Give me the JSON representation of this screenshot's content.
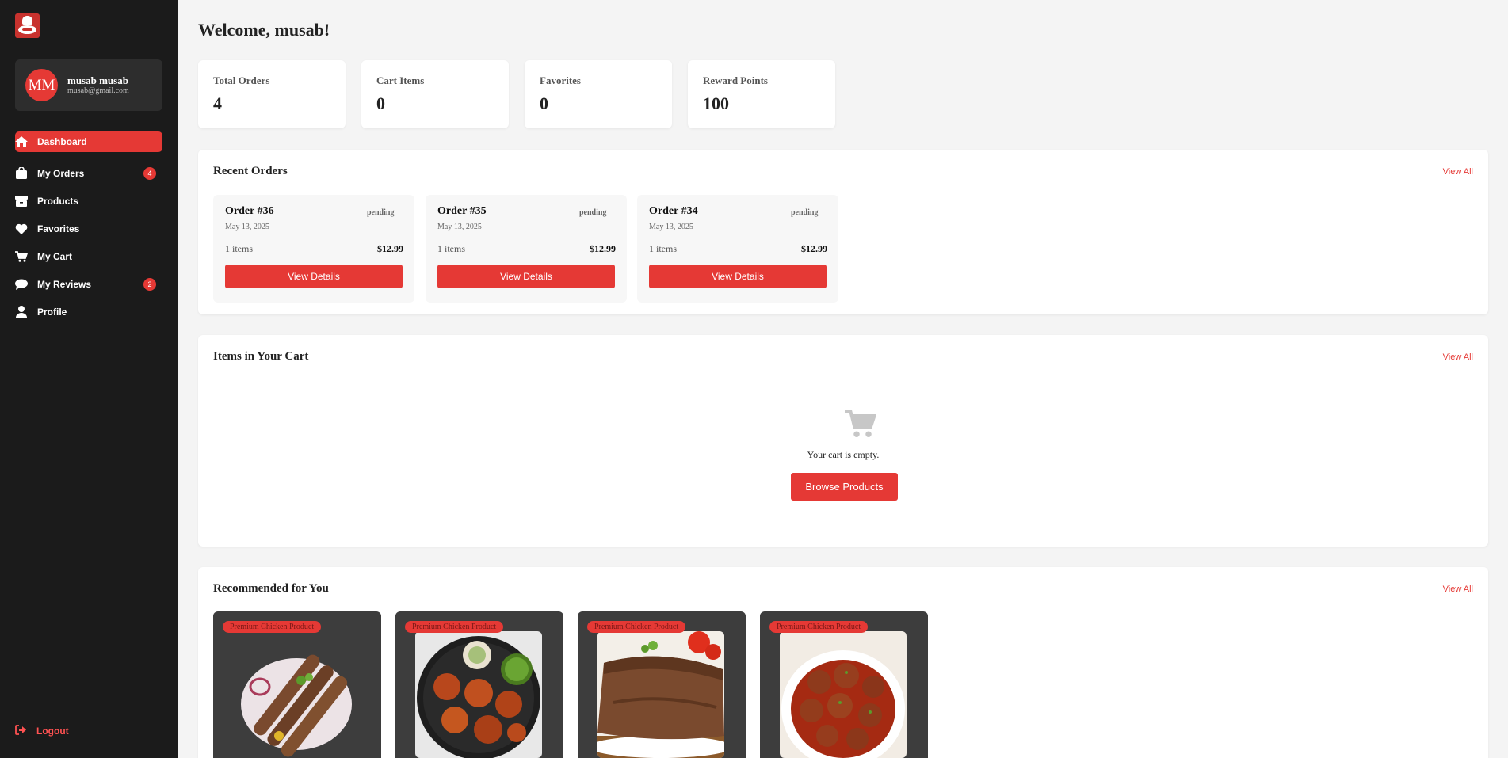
{
  "user": {
    "initials": "MM",
    "name": "musab musab",
    "email": "musab@gmail.com"
  },
  "nav": {
    "items": [
      {
        "label": "Dashboard",
        "icon": "home-icon",
        "active": true
      },
      {
        "label": "My Orders",
        "icon": "shopping-bag-icon",
        "badge": "4"
      },
      {
        "label": "Products",
        "icon": "box-icon"
      },
      {
        "label": "Favorites",
        "icon": "heart-icon"
      },
      {
        "label": "My Cart",
        "icon": "cart-icon"
      },
      {
        "label": "My Reviews",
        "icon": "comment-icon",
        "badge": "2"
      },
      {
        "label": "Profile",
        "icon": "user-icon"
      }
    ],
    "logout": "Logout"
  },
  "welcome": "Welcome, musab!",
  "stats": [
    {
      "label": "Total Orders",
      "value": "4"
    },
    {
      "label": "Cart Items",
      "value": "0"
    },
    {
      "label": "Favorites",
      "value": "0"
    },
    {
      "label": "Reward Points",
      "value": "100"
    }
  ],
  "recent_orders": {
    "title": "Recent Orders",
    "view_all": "View All",
    "orders": [
      {
        "title": "Order #36",
        "status": "pending",
        "date": "May 13, 2025",
        "items": "1 items",
        "price": "$12.99",
        "button": "View Details"
      },
      {
        "title": "Order #35",
        "status": "pending",
        "date": "May 13, 2025",
        "items": "1 items",
        "price": "$12.99",
        "button": "View Details"
      },
      {
        "title": "Order #34",
        "status": "pending",
        "date": "May 13, 2025",
        "items": "1 items",
        "price": "$12.99",
        "button": "View Details"
      }
    ]
  },
  "cart": {
    "title": "Items in Your Cart",
    "view_all": "View All",
    "empty_text": "Your cart is empty.",
    "browse_button": "Browse Products"
  },
  "recommended": {
    "title": "Recommended for You",
    "view_all": "View All",
    "products": [
      {
        "tag": "Premium Chicken Product"
      },
      {
        "tag": "Premium Chicken Product"
      },
      {
        "tag": "Premium Chicken Product"
      },
      {
        "tag": "Premium Chicken Product"
      }
    ]
  },
  "colors": {
    "accent": "#e53935",
    "sidebar": "#1b1b1b",
    "background": "#f4f4f4"
  }
}
